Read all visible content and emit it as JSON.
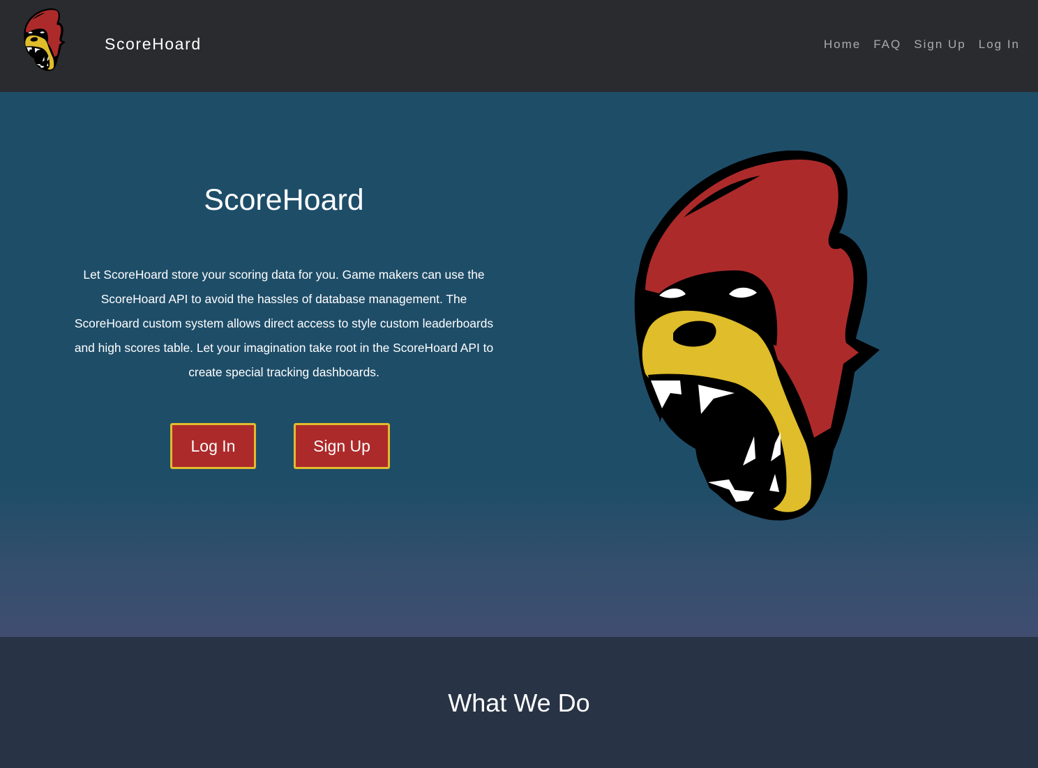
{
  "header": {
    "brand": "ScoreHoard",
    "logo_icon": "gorilla-mascot-icon",
    "nav": [
      {
        "label": "Home"
      },
      {
        "label": "FAQ"
      },
      {
        "label": "Sign Up"
      },
      {
        "label": "Log In"
      }
    ]
  },
  "hero": {
    "title": "ScoreHoard",
    "description": "Let ScoreHoard store your scoring data for you. Game makers can use the ScoreHoard API to avoid the hassles of database management. The ScoreHoard custom system allows direct access to style custom leaderboards and high scores table. Let your imagination take root in the ScoreHoard API to create special tracking dashboards.",
    "login_label": "Log In",
    "signup_label": "Sign Up",
    "mascot_icon": "gorilla-mascot-icon"
  },
  "section": {
    "title": "What We Do"
  },
  "colors": {
    "header_bg": "#2a2b2f",
    "hero_bg": "#1e4d68",
    "section_bg": "#283345",
    "button_bg": "#ad2a2b",
    "button_border": "#e1bb2e",
    "nav_text": "#a9abb0",
    "mascot_red": "#ad2a2b",
    "mascot_yellow": "#dfbd2b"
  }
}
